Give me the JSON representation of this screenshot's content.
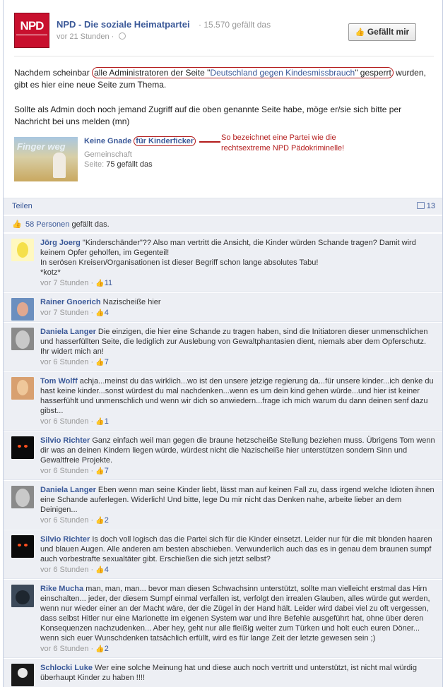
{
  "post": {
    "page_name": "NPD - Die soziale Heimatpartei",
    "likes_inline": "15.570 gefällt das",
    "time": "vor 21 Stunden",
    "logo_text": "NPD",
    "like_button": "Gefällt mir",
    "text_before_circle": "Nachdem scheinbar ",
    "circle_text_1": "alle Administratoren der Seite \"",
    "circle_link": "Deutschland gegen Kindesmissbrauch",
    "circle_text_2": "\" gesperrt",
    "text_after_circle": " wurden, gibt es hier eine neue Seite zum Thema.",
    "paragraph_2": "Sollte als Admin doch noch jemand Zugriff auf die oben genannte Seite habe, möge er/sie sich bitte per Nachricht bei uns melden (mn)"
  },
  "shared_page": {
    "image_title": "Finger weg",
    "title_part1": "Keine Gnade ",
    "title_part2_circled": "für Kinderficker",
    "type": "Gemeinschaft",
    "likes_label": "Seite:",
    "likes_value": "75 gefällt das",
    "annotation": "So bezeichnet eine Partei wie die rechtsextreme NPD Pädokriminelle!"
  },
  "actions": {
    "share": "Teilen",
    "comment_count": "13"
  },
  "likes": {
    "people": "58 Personen",
    "suffix": " gefällt das."
  },
  "comments": [
    {
      "author": "Jörg Joerg",
      "text": " \"Kinderschänder\"?? Also man vertritt die Ansicht, die Kinder würden Schande tragen? Damit wird keinem Opfer geholfen, im Gegenteil!",
      "text2": "In serösen Kreisen/Organisationen ist dieser Begriff schon lange absolutes Tabu!",
      "text3": "*kotz*",
      "time": "vor 7 Stunden",
      "likes": "11"
    },
    {
      "author": "Rainer Gnoerich",
      "text": " Nazischeiße hier",
      "time": "vor 7 Stunden",
      "likes": "4"
    },
    {
      "author": "Daniela Langer",
      "text": " Die einzigen, die hier eine Schande zu tragen haben, sind die Initiatoren dieser unmenschlichen und hasserfüllten Seite, die lediglich zur Auslebung von Gewaltphantasien dient, niemals aber dem Opferschutz. Ihr widert mich an!",
      "time": "vor 6 Stunden",
      "likes": "7"
    },
    {
      "author": "Tom Wolff",
      "text": " achja...meinst du das wirklich...wo ist den unsere jetzige regierung da...für unsere kinder...ich denke du hast keine kinder...sonst würdest du mal nachdenken...wenn es um dein kind gehen würde...und hier ist keiner hasserfühlt und unmenschlich und wenn wir dich so anwiedern...frage ich mich warum du dann deinen senf dazu gibst...",
      "time": "vor 6 Stunden",
      "likes": "1"
    },
    {
      "author": "Silvio Richter",
      "text": " Ganz einfach weil man gegen die braune hetzscheiße Stellung beziehen muss. Übrigens Tom wenn dir was an deinen Kindern liegen würde, würdest nicht die Nazischeiße hier unterstützen sondern Sinn und Gewaltfreie Projekte.",
      "time": "vor 6 Stunden",
      "likes": "7"
    },
    {
      "author": "Daniela Langer",
      "text": " Eben wenn man seine Kinder liebt, lässt man auf keinen Fall zu, dass irgend welche Idioten ihnen eine Schande auferlegen. Widerlich! Und bitte, lege Du mir nicht das Denken nahe, arbeite lieber an dem Deinigen...",
      "time": "vor 6 Stunden",
      "likes": "2"
    },
    {
      "author": "Silvio Richter",
      "text": " Is doch voll logisch das die Partei sich für die Kinder einsetzt. Leider nur für die mit blonden haaren und blauen Augen. Alle anderen am besten abschieben. Verwunderlich auch das es in genau dem braunen sumpf auch vorbestrafte sexualtäter gibt. Erschießen die sich jetzt selbst?",
      "time": "vor 6 Stunden",
      "likes": "4"
    },
    {
      "author": "Rike Mucha",
      "text": " man, man, man... bevor man diesen Schwachsinn unterstützt, sollte man vielleicht erstmal das Hirn einschalten... jeder, der diesem Sumpf einmal verfallen ist, verfolgt den irrealen Glauben, alles würde gut werden, wenn nur wieder einer an der Macht wäre, der die Zügel in der Hand hält. Leider wird dabei viel zu oft vergessen, dass selbst Hitler nur eine Marionette im eigenen System war und ihre Befehle ausgeführt hat, ohne über deren Konsequenzen nachzudenken... Aber hey, geht nur alle fleißig weiter zum Türken und holt euch euren Döner... wenn sich euer Wunschdenken tatsächlich erfüllt, wird es für lange Zeit der letzte gewesen sein ;)",
      "time": "vor 6 Stunden",
      "likes": "2"
    },
    {
      "author": "Schlocki Luke",
      "text": " Wer eine solche Meinung hat und diese auch noch vertritt und unterstützt, ist nicht mal würdig überhaupt Kinder zu haben !!!!",
      "time": "",
      "likes": ""
    }
  ]
}
